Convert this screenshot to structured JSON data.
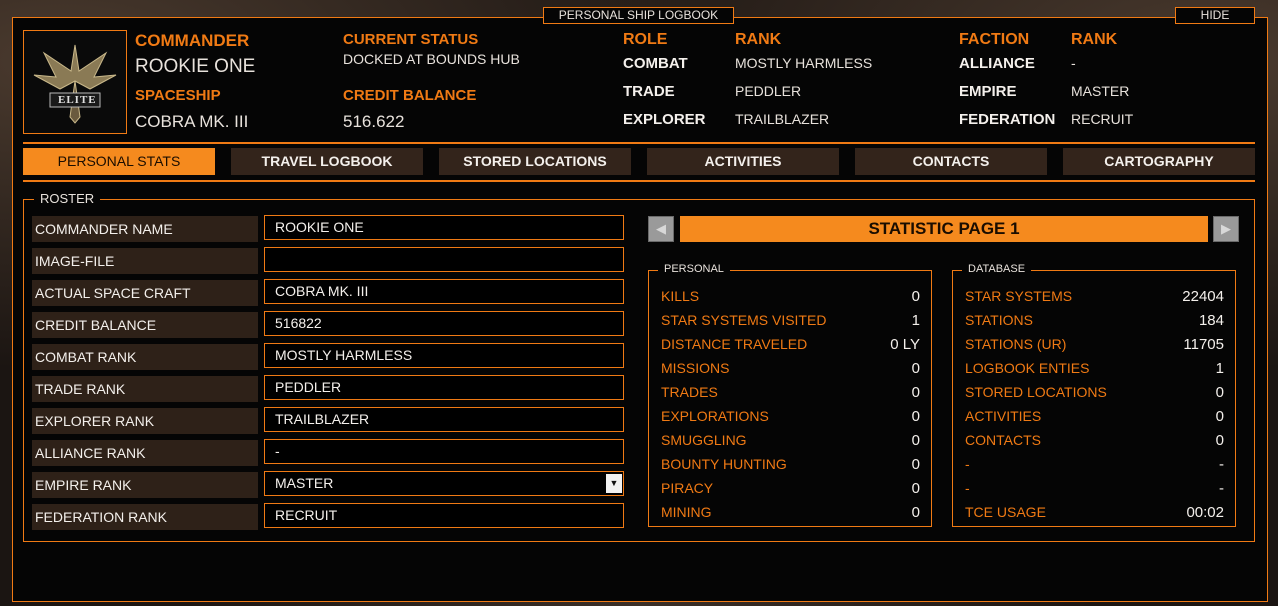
{
  "title": "PERSONAL SHIP LOGBOOK",
  "hide_label": "HIDE",
  "header": {
    "commander_label": "COMMANDER",
    "commander_name": "ROOKIE ONE",
    "spaceship_label": "SPACESHIP",
    "spaceship_name": "COBRA MK. III",
    "status_label": "CURRENT STATUS",
    "status_value": "DOCKED AT BOUNDS HUB",
    "credit_label": "CREDIT BALANCE",
    "credit_value": "516.622",
    "role_label": "ROLE",
    "rank_label": "RANK",
    "roles": [
      {
        "role": "COMBAT",
        "rank": "MOSTLY HARMLESS"
      },
      {
        "role": "TRADE",
        "rank": "PEDDLER"
      },
      {
        "role": "EXPLORER",
        "rank": "TRAILBLAZER"
      }
    ],
    "faction_label": "FACTION",
    "faction_rank_label": "RANK",
    "factions": [
      {
        "faction": "ALLIANCE",
        "rank": "-"
      },
      {
        "faction": "EMPIRE",
        "rank": "MASTER"
      },
      {
        "faction": "FEDERATION",
        "rank": "RECRUIT"
      }
    ],
    "logo_text": "ELITE"
  },
  "tabs": [
    "PERSONAL STATS",
    "TRAVEL LOGBOOK",
    "STORED LOCATIONS",
    "ACTIVITIES",
    "CONTACTS",
    "CARTOGRAPHY"
  ],
  "roster": {
    "legend": "ROSTER",
    "rows": [
      {
        "label": "COMMANDER NAME",
        "value": "ROOKIE ONE"
      },
      {
        "label": "IMAGE-FILE",
        "value": ""
      },
      {
        "label": "ACTUAL SPACE CRAFT",
        "value": "COBRA MK. III"
      },
      {
        "label": "CREDIT BALANCE",
        "value": "516822"
      },
      {
        "label": "COMBAT RANK",
        "value": "MOSTLY HARMLESS"
      },
      {
        "label": "TRADE RANK",
        "value": "PEDDLER"
      },
      {
        "label": "EXPLORER RANK",
        "value": "TRAILBLAZER"
      },
      {
        "label": "ALLIANCE RANK",
        "value": "-"
      },
      {
        "label": "EMPIRE RANK",
        "value": "MASTER"
      },
      {
        "label": "FEDERATION RANK",
        "value": "RECRUIT"
      }
    ]
  },
  "stats": {
    "page_title": "STATISTIC PAGE 1",
    "prev_icon": "◀",
    "next_icon": "▶",
    "personal_legend": "PERSONAL",
    "personal": [
      {
        "label": "KILLS",
        "value": "0"
      },
      {
        "label": "STAR SYSTEMS VISITED",
        "value": "1"
      },
      {
        "label": "DISTANCE TRAVELED",
        "value": "0 LY"
      },
      {
        "label": "MISSIONS",
        "value": "0"
      },
      {
        "label": "TRADES",
        "value": "0"
      },
      {
        "label": "EXPLORATIONS",
        "value": "0"
      },
      {
        "label": "SMUGGLING",
        "value": "0"
      },
      {
        "label": "BOUNTY HUNTING",
        "value": "0"
      },
      {
        "label": "PIRACY",
        "value": "0"
      },
      {
        "label": "MINING",
        "value": "0"
      }
    ],
    "database_legend": "DATABASE",
    "database": [
      {
        "label": "STAR SYSTEMS",
        "value": "22404"
      },
      {
        "label": "STATIONS",
        "value": "184"
      },
      {
        "label": "STATIONS (UR)",
        "value": "11705"
      },
      {
        "label": "LOGBOOK ENTIES",
        "value": "1"
      },
      {
        "label": "STORED LOCATIONS",
        "value": "0"
      },
      {
        "label": "ACTIVITIES",
        "value": "0"
      },
      {
        "label": "CONTACTS",
        "value": "0"
      },
      {
        "label": "-",
        "value": "-"
      },
      {
        "label": "-",
        "value": "-"
      },
      {
        "label": "TCE USAGE",
        "value": "00:02"
      }
    ]
  },
  "colors": {
    "accent": "#f07a14",
    "tab_active": "#f58a1e",
    "row_bg": "#2e2118"
  }
}
